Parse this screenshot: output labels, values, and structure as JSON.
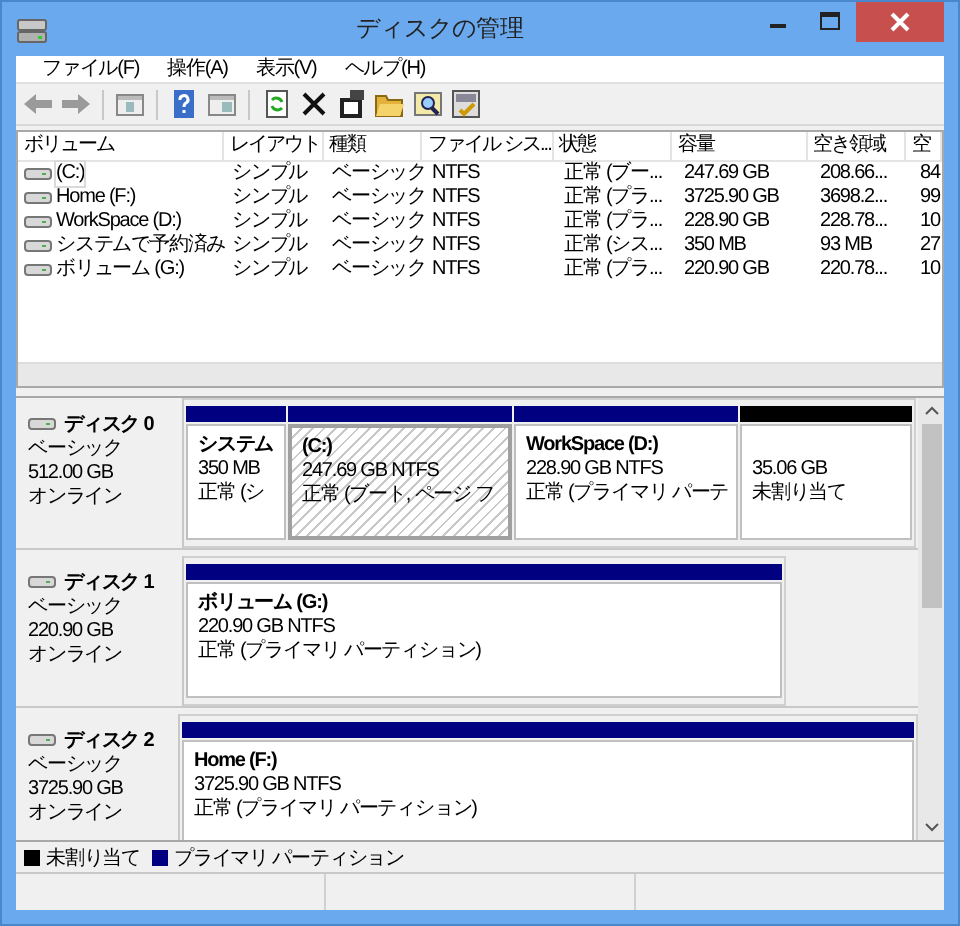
{
  "window": {
    "title": "ディスクの管理"
  },
  "menu": [
    "ファイル(F)",
    "操作(A)",
    "表示(V)",
    "ヘルプ(H)"
  ],
  "volume_list": {
    "columns": [
      "ボリューム",
      "レイアウト",
      "種類",
      "ファイル シス...",
      "状態",
      "容量",
      "空き領域",
      "空"
    ],
    "rows": [
      {
        "selected": true,
        "cells": [
          "(C:)",
          "シンプル",
          "ベーシック",
          "NTFS",
          "正常 (ブー...",
          "247.69 GB",
          "208.66...",
          "84"
        ]
      },
      {
        "selected": false,
        "cells": [
          "Home (F:)",
          "シンプル",
          "ベーシック",
          "NTFS",
          "正常 (プラ...",
          "3725.90 GB",
          "3698.2...",
          "99"
        ]
      },
      {
        "selected": false,
        "cells": [
          "WorkSpace (D:)",
          "シンプル",
          "ベーシック",
          "NTFS",
          "正常 (プラ...",
          "228.90 GB",
          "228.78...",
          "10"
        ]
      },
      {
        "selected": false,
        "cells": [
          "システムで予約済み",
          "シンプル",
          "ベーシック",
          "NTFS",
          "正常 (シス...",
          "350 MB",
          "93 MB",
          "27"
        ]
      },
      {
        "selected": false,
        "cells": [
          "ボリューム (G:)",
          "シンプル",
          "ベーシック",
          "NTFS",
          "正常 (プラ...",
          "220.90 GB",
          "220.78...",
          "10"
        ]
      }
    ]
  },
  "disks": [
    {
      "name": "ディスク 0",
      "type": "ベーシック",
      "size": "512.00 GB",
      "status": "オンライン",
      "partitions": [
        {
          "kind": "primary",
          "selected": false,
          "name": "システム",
          "size": "350 MB",
          "status": "正常 (シ"
        },
        {
          "kind": "primary",
          "selected": true,
          "name": "(C:)",
          "size": "247.69 GB NTFS",
          "status": "正常 (ブート, ページ フ"
        },
        {
          "kind": "primary",
          "selected": false,
          "name": "WorkSpace  (D:)",
          "size": "228.90 GB NTFS",
          "status": "正常 (プライマリ パーテ"
        },
        {
          "kind": "unallocated",
          "selected": false,
          "size": "35.06 GB",
          "status": "未割り当て"
        }
      ]
    },
    {
      "name": "ディスク 1",
      "type": "ベーシック",
      "size": "220.90 GB",
      "status": "オンライン",
      "partitions": [
        {
          "kind": "primary",
          "selected": false,
          "name": "ボリューム  (G:)",
          "size": "220.90 GB NTFS",
          "status": "正常 (プライマリ パーティション)"
        }
      ]
    },
    {
      "name": "ディスク 2",
      "type": "ベーシック",
      "size": "3725.90 GB",
      "status": "オンライン",
      "partitions": [
        {
          "kind": "primary",
          "selected": false,
          "name": "Home  (F:)",
          "size": "3725.90 GB NTFS",
          "status": "正常 (プライマリ パーティション)"
        }
      ]
    }
  ],
  "legend": [
    {
      "label": "未割り当て",
      "color": "#000000"
    },
    {
      "label": "プライマリ パーティション",
      "color": "#000080"
    }
  ]
}
